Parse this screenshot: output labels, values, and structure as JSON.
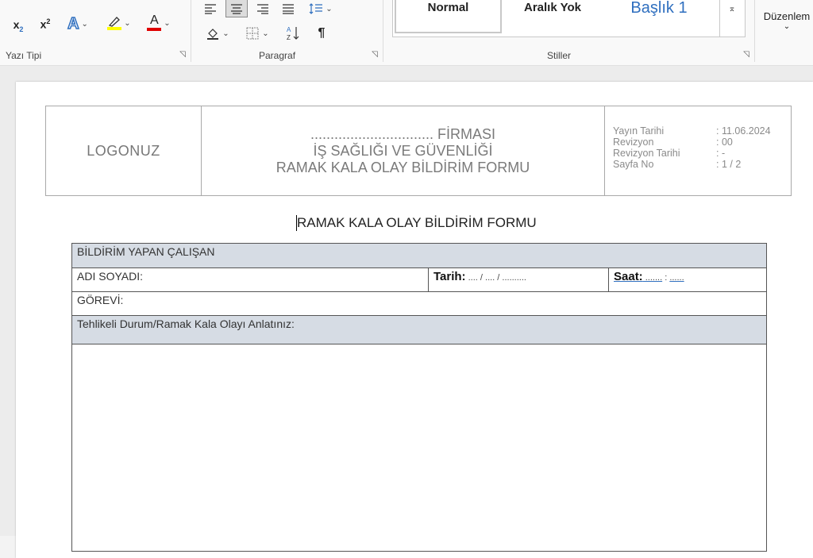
{
  "ribbon": {
    "font_group": {
      "label": "Yazı Tipi",
      "subscript": "x₂",
      "superscript": "x²",
      "text_effects": "A",
      "highlight": "🖊",
      "font_color": "A"
    },
    "paragraph_group": {
      "label": "Paragraf",
      "pilcrow": "¶",
      "sort": "A↓Z"
    },
    "styles_group": {
      "label": "Stiller",
      "styles": [
        "Normal",
        "Aralık Yok",
        "Başlık 1"
      ]
    },
    "editing": {
      "label": "Düzenlem"
    },
    "colors": {
      "highlight": "#ffff00",
      "font_color": "#e00000",
      "heading": "#2f6fbf",
      "table_shade": "#d6dce4"
    }
  },
  "document": {
    "header": {
      "logo": "LOGONUZ",
      "title_line1": "............................... FİRMASI",
      "title_line2": "İŞ SAĞLIĞI VE GÜVENLİĞİ",
      "title_line3": "RAMAK KALA OLAY BİLDİRİM FORMU",
      "meta": [
        {
          "key": "Yayın Tarihi",
          "value": ": 11.06.2024"
        },
        {
          "key": "Revizyon",
          "value": ": 00"
        },
        {
          "key": "Revizyon Tarihi",
          "value": ": -"
        },
        {
          "key": "Sayfa No",
          "value": ": 1 / 2"
        }
      ]
    },
    "form_title": "RAMAK KALA OLAY BİLDİRİM FORMU",
    "form": {
      "section1": "BİLDİRİM YAPAN ÇALIŞAN",
      "name_label": "ADI SOYADI:",
      "date_label": "Tarih:",
      "date_value": " .... / .... / ..........",
      "time_label": "Saat:",
      "time_value1": " .......",
      "time_sep": " : ",
      "time_value2": "......",
      "role_label": "GÖREVİ:",
      "description_label": "Tehlikeli Durum/Ramak Kala Olayı Anlatınız:"
    }
  }
}
